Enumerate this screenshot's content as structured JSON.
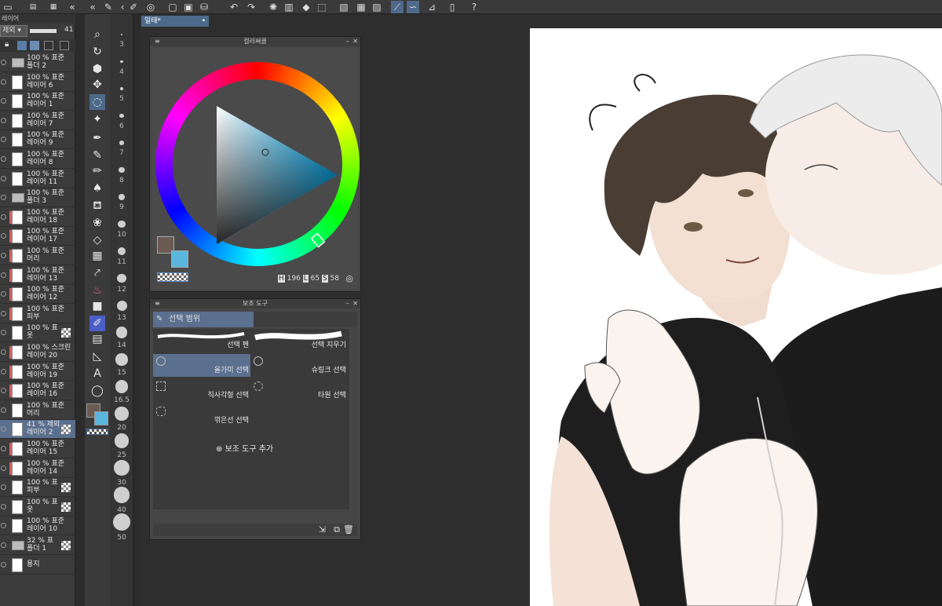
{
  "toolbar": {
    "icons": [
      "layer-panel-icon",
      "undo-icon",
      "redo-icon",
      "loading-icon",
      "fill-icon",
      "transform-icon",
      "ruler-icon",
      "grid-icon",
      "snap-icon",
      "settings-icon",
      "help-icon"
    ]
  },
  "layer_panel": {
    "header_label": "레이어",
    "blend_mode": "제외",
    "opacity": "41",
    "layers": [
      {
        "l1": "100 % 표준",
        "l2": "폴더 2",
        "kind": "folder"
      },
      {
        "l1": "100 % 표준",
        "l2": "레이어 6"
      },
      {
        "l1": "100 % 표준",
        "l2": "레이어 1"
      },
      {
        "l1": "100 % 표준",
        "l2": "레이어 7"
      },
      {
        "l1": "100 % 표준",
        "l2": "레이어 9"
      },
      {
        "l1": "100 % 표준",
        "l2": "레이어 8"
      },
      {
        "l1": "100 % 표준",
        "l2": "레이어 11"
      },
      {
        "l1": "100 % 표준",
        "l2": "폴더 3",
        "kind": "folder"
      },
      {
        "l1": "100 % 표준",
        "l2": "레이어 18"
      },
      {
        "l1": "100 % 표준",
        "l2": "레이어 17"
      },
      {
        "l1": "100 % 표준",
        "l2": "머리"
      },
      {
        "l1": "100 % 표준",
        "l2": "레이어 13"
      },
      {
        "l1": "100 % 표준",
        "l2": "레이어 12"
      },
      {
        "l1": "100 % 표준",
        "l2": "피부"
      },
      {
        "l1": "100 % 표",
        "l2": "옷"
      },
      {
        "l1": "100 % 스크린",
        "l2": "레이어 20"
      },
      {
        "l1": "100 % 표준",
        "l2": "레이어 19"
      },
      {
        "l1": "100 % 표준",
        "l2": "레이어 16"
      },
      {
        "l1": "100 % 표준",
        "l2": "머리"
      },
      {
        "l1": "41 % 제외",
        "l2": "레이어 2"
      },
      {
        "l1": "100 % 표준",
        "l2": "레이어 15"
      },
      {
        "l1": "100 % 표준",
        "l2": "레이어 14"
      },
      {
        "l1": "100 % 표",
        "l2": "피부"
      },
      {
        "l1": "100 % 표",
        "l2": "옷"
      },
      {
        "l1": "100 % 표준",
        "l2": "레이어 10"
      },
      {
        "l1": "32 % 표",
        "l2": "폴더 1",
        "kind": "folder"
      },
      {
        "l1": "",
        "l2": "용지"
      }
    ]
  },
  "brush_sizes": [
    "3",
    "4",
    "5",
    "6",
    "7",
    "8",
    "9",
    "10",
    "11",
    "12",
    "13",
    "14",
    "15",
    "16.5",
    "20",
    "25",
    "30",
    "40",
    "50"
  ],
  "document_tab": {
    "title": "일태*"
  },
  "color_circle": {
    "title": "컬러써클",
    "h_label": "H",
    "h": "196",
    "l_label": "L",
    "l": "65",
    "s_label": "S",
    "s": "58",
    "main_color": "#6a5a52",
    "sub_color": "#5ab6dc"
  },
  "sub_tool": {
    "title": "보조 도구",
    "group": "선택 범위",
    "items": [
      "선택 펜",
      "선택 지우기",
      "올가미 선택",
      "슈링크 선택",
      "직사각형 선택",
      "타원 선택",
      "꺾은선 선택"
    ],
    "add_label": "보조 도구 추가"
  }
}
